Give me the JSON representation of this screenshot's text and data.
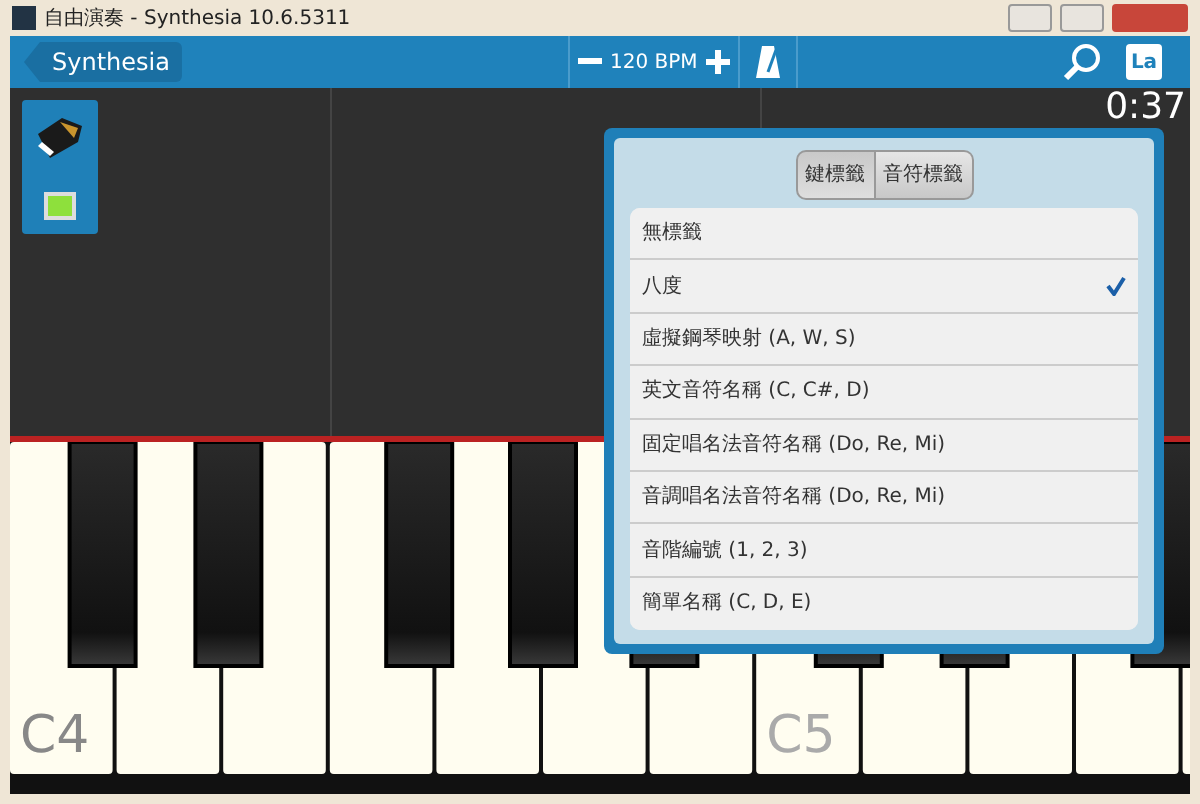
{
  "window": {
    "title": "自由演奏 - Synthesia 10.6.5311"
  },
  "toolbar": {
    "back_button": "Synthesia",
    "tempo": "120 BPM",
    "labels_button": "La"
  },
  "timer": "0:37",
  "piano": {
    "octaves": [
      {
        "label": "C4"
      },
      {
        "label": "C5"
      }
    ]
  },
  "popup": {
    "tabs": [
      {
        "label": "鍵標籤",
        "selected": true
      },
      {
        "label": "音符標籤",
        "selected": false
      }
    ],
    "options": [
      {
        "label": "無標籤",
        "selected": false
      },
      {
        "label": "八度",
        "selected": true
      },
      {
        "label": "虛擬鋼琴映射 (A, W, S)",
        "selected": false
      },
      {
        "label": "英文音符名稱 (C, C#, D)",
        "selected": false
      },
      {
        "label": "固定唱名法音符名稱 (Do, Re, Mi)",
        "selected": false
      },
      {
        "label": "音調唱名法音符名稱 (Do, Re, Mi)",
        "selected": false
      },
      {
        "label": "音階編號 (1, 2, 3)",
        "selected": false
      },
      {
        "label": "簡單名稱 (C, D, E)",
        "selected": false
      }
    ]
  }
}
